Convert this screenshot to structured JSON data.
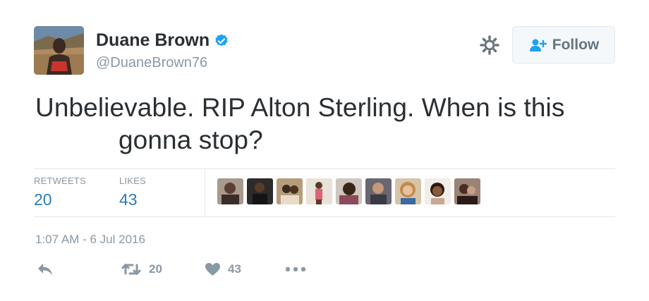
{
  "user": {
    "name": "Duane Brown",
    "screen_name": "@DuaneBrown76",
    "verified": true
  },
  "follow_button": {
    "label": "Follow"
  },
  "tweet": {
    "text_line1": "Unbelievable. RIP Alton Sterling. When is this",
    "text_line2": "gonna stop?"
  },
  "stats": {
    "retweets_label": "RETWEETS",
    "retweets_value": "20",
    "likes_label": "LIKES",
    "likes_value": "43"
  },
  "likers": [
    {
      "icon": "avatar-1"
    },
    {
      "icon": "avatar-2"
    },
    {
      "icon": "avatar-3"
    },
    {
      "icon": "avatar-4"
    },
    {
      "icon": "avatar-5"
    },
    {
      "icon": "avatar-6"
    },
    {
      "icon": "avatar-7"
    },
    {
      "icon": "avatar-8"
    },
    {
      "icon": "avatar-9"
    }
  ],
  "timestamp": "1:07 AM - 6 Jul 2016",
  "actions": {
    "retweet_count": "20",
    "like_count": "43"
  },
  "colors": {
    "text": "#292f33",
    "muted": "#8899a6",
    "link": "#2b7bb9",
    "verified": "#1da1f2",
    "border": "#e1e8ed"
  },
  "icons": [
    "verified-icon",
    "gear-icon",
    "follow-person-icon",
    "reply-icon",
    "retweet-icon",
    "heart-icon",
    "more-icon"
  ]
}
